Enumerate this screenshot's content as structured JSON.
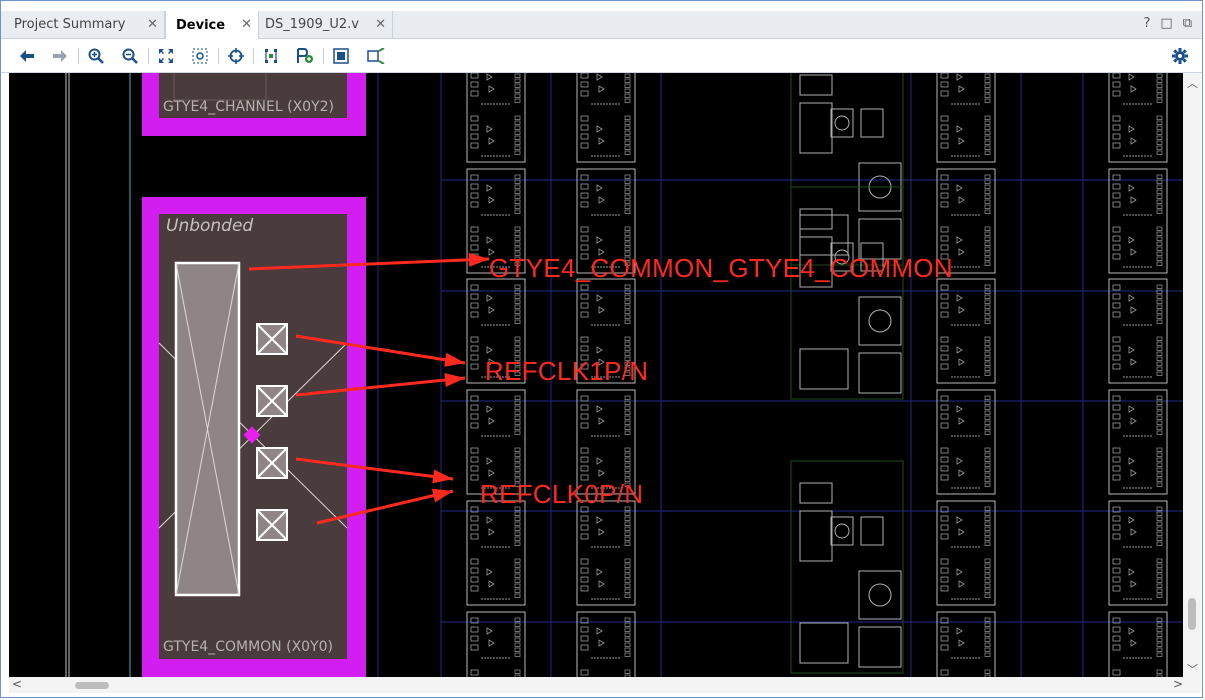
{
  "tabs": [
    {
      "label": "Project Summary",
      "active": false
    },
    {
      "label": "Device",
      "active": true
    },
    {
      "label": "DS_1909_U2.v",
      "active": false
    }
  ],
  "window_buttons": [
    "?",
    "□",
    "⧉"
  ],
  "toolbar": {
    "icons": [
      "back-icon",
      "forward-icon",
      "zoom-in-icon",
      "zoom-out-icon",
      "zoom-fit-icon",
      "zoom-selection-icon",
      "crosshair-icon",
      "route-icon",
      "add-pblock-icon",
      "package-view-icon",
      "select-area-icon",
      "settings-icon"
    ]
  },
  "device": {
    "channel_label": "GTYE4_CHANNEL (X0Y2)",
    "unbonded_label": "Unbonded",
    "common_label": "GTYE4_COMMON (X0Y0)"
  },
  "annotations": {
    "common": "GTYE4_COMMON_GTYE4_COMMON",
    "refclk1": "REFCLK1P/N",
    "refclk0": "REFCLK0P/N",
    "color": "#ff2a1f"
  },
  "colors": {
    "site_highlight": "#d21ef0",
    "site_fill": "#4a3c3c",
    "canvas_bg": "#000000",
    "grid_line": "#1f2a8a"
  }
}
